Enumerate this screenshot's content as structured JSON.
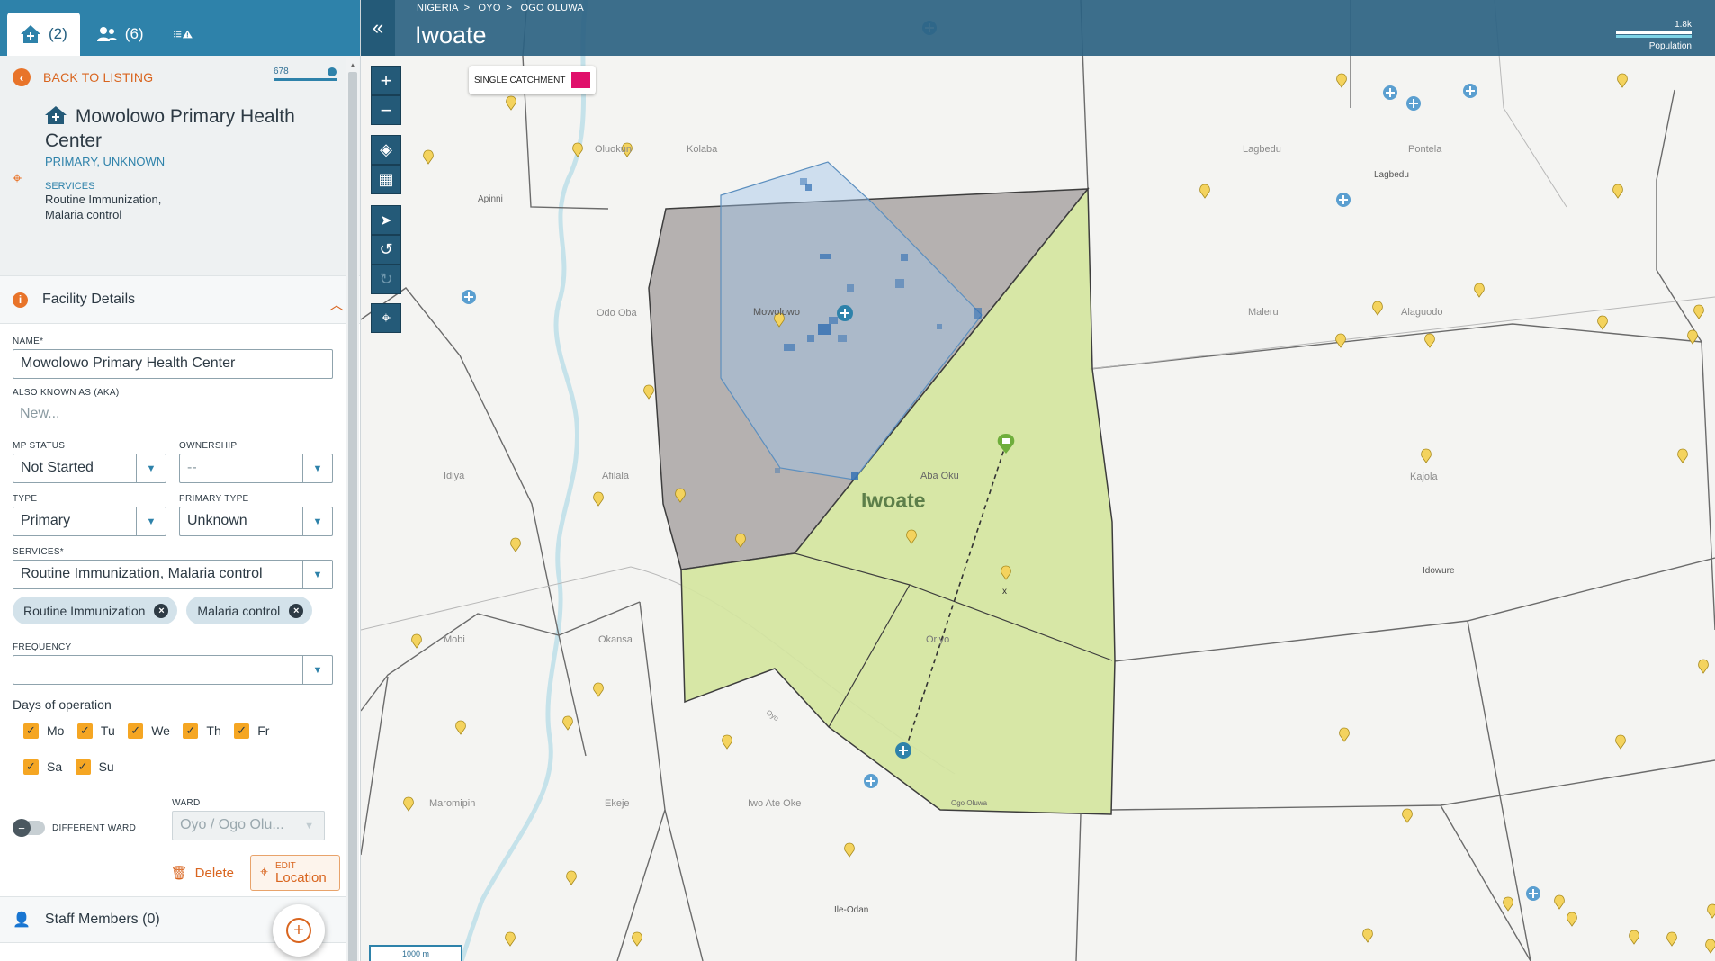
{
  "tabs": [
    {
      "label": "(2)",
      "icon": "home-plus-icon"
    },
    {
      "label": "(6)",
      "icon": "users-icon"
    },
    {
      "label": "",
      "icon": "list-warning-icon"
    }
  ],
  "back_label": "BACK TO LISTING",
  "score_value": "678",
  "facility": {
    "name": "Mowolowo Primary Health Center",
    "subtitle": "PRIMARY, UNKNOWN",
    "services_label": "SERVICES",
    "services_line1": "Routine Immunization,",
    "services_line2": "Malaria control"
  },
  "details": {
    "title": "Facility Details",
    "name_label": "NAME*",
    "name_value": "Mowolowo Primary Health Center",
    "aka_label": "ALSO KNOWN AS (AKA)",
    "aka_placeholder": "New...",
    "mp_status_label": "MP STATUS",
    "mp_status_value": "Not Started",
    "ownership_label": "OWNERSHIP",
    "ownership_value": "--",
    "type_label": "TYPE",
    "type_value": "Primary",
    "primary_type_label": "PRIMARY TYPE",
    "primary_type_value": "Unknown",
    "services_label": "SERVICES*",
    "services_value": "Routine Immunization, Malaria control",
    "chips": [
      "Routine Immunization",
      "Malaria control"
    ],
    "frequency_label": "FREQUENCY",
    "frequency_value": "",
    "days_label": "Days of operation",
    "days": [
      "Mo",
      "Tu",
      "We",
      "Th",
      "Fr",
      "Sa",
      "Su"
    ],
    "different_ward_label": "DIFFERENT WARD",
    "ward_label": "WARD",
    "ward_value": "Oyo / Ogo Olu...",
    "delete_label": "Delete",
    "edit_top": "EDIT",
    "edit_bottom": "Location"
  },
  "staff_label": "Staff Members (0)",
  "map": {
    "breadcrumb": [
      "NIGERIA",
      "OYO",
      "OGO OLUWA"
    ],
    "title": "Iwoate",
    "population_value": "1.8k",
    "population_label": "Population",
    "legend_label": "SINGLE CATCHMENT",
    "legend_color": "#e0106b",
    "region_label": "Iwoate",
    "scale_label": "1000 m",
    "place_labels": {
      "oluokun": "Oluokun",
      "kolaba": "Kolaba",
      "apinni": "Apinni",
      "odo_oba": "Odo Oba",
      "mowolowo": "Mowolowo",
      "idiya": "Idiya",
      "afilala": "Afilala",
      "aba_oku": "Aba Oku",
      "mobi": "Mobi",
      "okansa": "Okansa",
      "oriyo": "Oriyo",
      "maromipin": "Maromipin",
      "ekeje": "Ekeje",
      "iwo_ate_oke": "Iwo Ate Oke",
      "ile_odan": "Ile-Odan",
      "lagbedu_small": "Lagbedu",
      "lagbedu": "Lagbedu",
      "pontela": "Pontela",
      "maleru": "Maleru",
      "alaguodo": "Alaguodo",
      "kajola": "Kajola",
      "idowure": "Idowure",
      "ogo_oluwa_road": "Ogo Oluwa",
      "oyo_road": "Oyo",
      "x_marker": "x"
    },
    "colors": {
      "catchment_green": "#d4e5a0",
      "catchment_gray": "#a9a5a5",
      "catchment_blue": "#9fc4e8",
      "facility_marker": "#2e82aa",
      "settlement_marker": "#f4d35e"
    }
  }
}
